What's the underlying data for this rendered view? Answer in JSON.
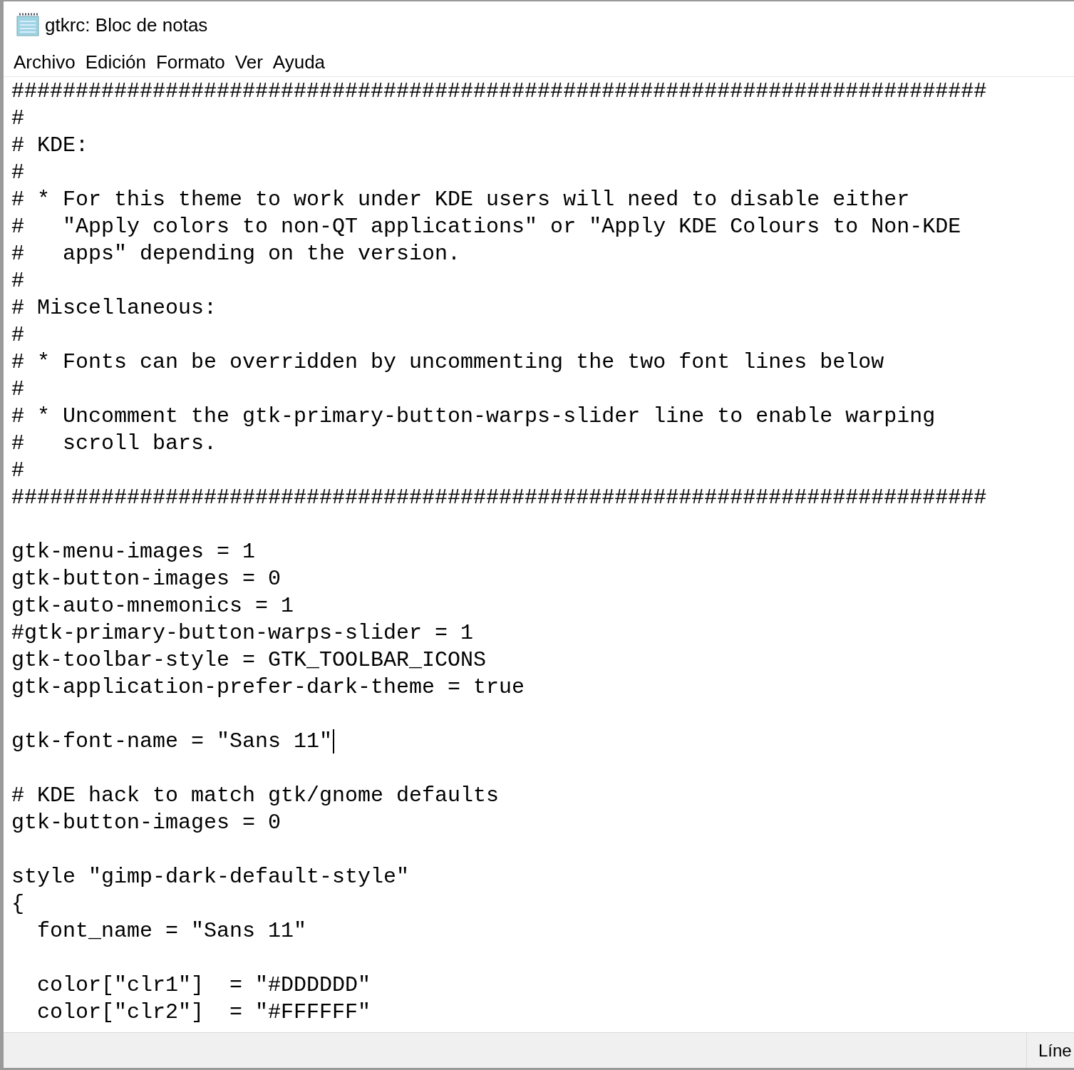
{
  "window": {
    "title": "gtkrc: Bloc de notas"
  },
  "menu": [
    "Archivo",
    "Edición",
    "Formato",
    "Ver",
    "Ayuda"
  ],
  "editor": {
    "blocks": [
      [
        {
          "text": "############################################################################",
          "cursor": false
        },
        {
          "text": "#",
          "cursor": false
        },
        {
          "text": "# KDE:",
          "cursor": false
        },
        {
          "text": "#",
          "cursor": false
        },
        {
          "text": "# * For this theme to work under KDE users will need to disable either",
          "cursor": false
        },
        {
          "text": "#   \"Apply colors to non-QT applications\" or \"Apply KDE Colours to Non-KDE",
          "cursor": false
        },
        {
          "text": "#   apps\" depending on the version.",
          "cursor": false
        },
        {
          "text": "#",
          "cursor": false
        },
        {
          "text": "# Miscellaneous:",
          "cursor": false
        },
        {
          "text": "#",
          "cursor": false
        },
        {
          "text": "# * Fonts can be overridden by uncommenting the two font lines below",
          "cursor": false
        },
        {
          "text": "#",
          "cursor": false
        },
        {
          "text": "# * Uncomment the gtk-primary-button-warps-slider line to enable warping",
          "cursor": false
        },
        {
          "text": "#   scroll bars.",
          "cursor": false
        },
        {
          "text": "#",
          "cursor": false
        },
        {
          "text": "############################################################################",
          "cursor": false
        }
      ],
      [
        {
          "text": "gtk-menu-images = 1",
          "cursor": false
        },
        {
          "text": "gtk-button-images = 0",
          "cursor": false
        },
        {
          "text": "gtk-auto-mnemonics = 1",
          "cursor": false
        },
        {
          "text": "#gtk-primary-button-warps-slider = 1",
          "cursor": false
        },
        {
          "text": "gtk-toolbar-style = GTK_TOOLBAR_ICONS",
          "cursor": false
        },
        {
          "text": "gtk-application-prefer-dark-theme = true",
          "cursor": false
        }
      ],
      [
        {
          "text": "gtk-font-name = \"Sans 11\"",
          "cursor": true
        }
      ],
      [
        {
          "text": "# KDE hack to match gtk/gnome defaults",
          "cursor": false
        },
        {
          "text": "gtk-button-images = 0",
          "cursor": false
        }
      ],
      [
        {
          "text": "style \"gimp-dark-default-style\"",
          "cursor": false
        },
        {
          "text": "{",
          "cursor": false
        },
        {
          "text": "  font_name = \"Sans 11\"",
          "cursor": false
        }
      ],
      [
        {
          "text": "  color[\"clr1\"]  = \"#DDDDDD\"",
          "cursor": false
        },
        {
          "text": "  color[\"clr2\"]  = \"#FFFFFF\"",
          "cursor": false
        }
      ]
    ]
  },
  "status_bar": {
    "position": "Líne"
  }
}
